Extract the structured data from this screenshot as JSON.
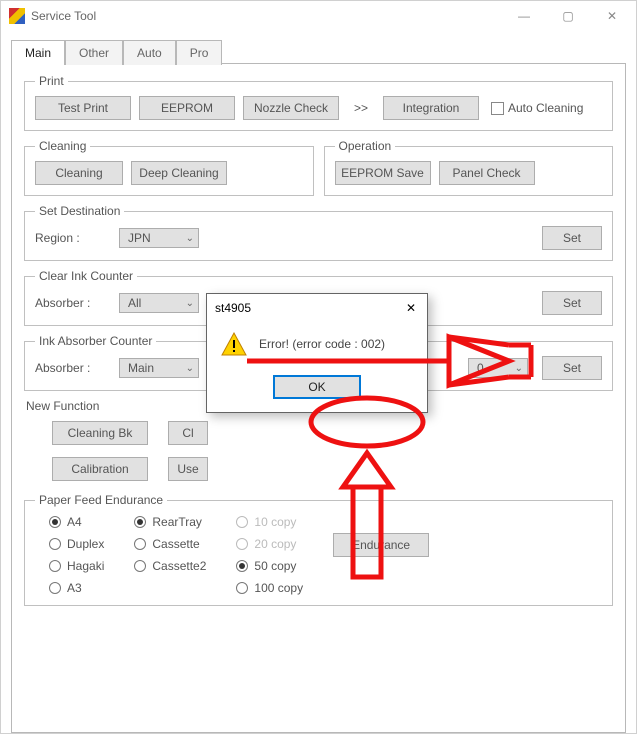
{
  "window": {
    "title": "Service Tool",
    "btn_min": "—",
    "btn_max": "▢",
    "btn_close": "✕"
  },
  "tabs": {
    "main": "Main",
    "other": "Other",
    "auto": "Auto",
    "pro": "Pro"
  },
  "print": {
    "legend": "Print",
    "test": "Test Print",
    "eeprom": "EEPROM",
    "nozzle": "Nozzle Check",
    "more": ">>",
    "integration": "Integration",
    "autoclean": "Auto Cleaning"
  },
  "cleaning": {
    "legend": "Cleaning",
    "cleaning": "Cleaning",
    "deep": "Deep Cleaning"
  },
  "operation": {
    "legend": "Operation",
    "save": "EEPROM Save",
    "panel": "Panel Check"
  },
  "setdest": {
    "legend": "Set Destination",
    "label": "Region :",
    "value": "JPN",
    "set": "Set"
  },
  "clearink": {
    "legend": "Clear Ink Counter",
    "label": "Absorber :",
    "value": "All",
    "set": "Set"
  },
  "inkabs": {
    "legend": "Ink Absorber Counter",
    "label": "Absorber :",
    "value": "Main",
    "value2": "0",
    "set": "Set"
  },
  "newfunc": {
    "title": "New Function",
    "bk": "Cleaning Bk",
    "cl": "Cl",
    "calib": "Calibration",
    "use": "Use"
  },
  "pfe": {
    "legend": "Paper Feed Endurance",
    "c1": [
      "A4",
      "Duplex",
      "Hagaki",
      "A3"
    ],
    "c2": [
      "RearTray",
      "Cassette",
      "Cassette2"
    ],
    "c3": [
      "10 copy",
      "20 copy",
      "50 copy",
      "100 copy"
    ],
    "c1sel": 0,
    "c2sel": 0,
    "c3sel": 2,
    "endurance": "Endurance"
  },
  "dialog": {
    "title": "st4905",
    "message": "Error! (error code : 002)",
    "ok": "OK",
    "close": "✕"
  }
}
